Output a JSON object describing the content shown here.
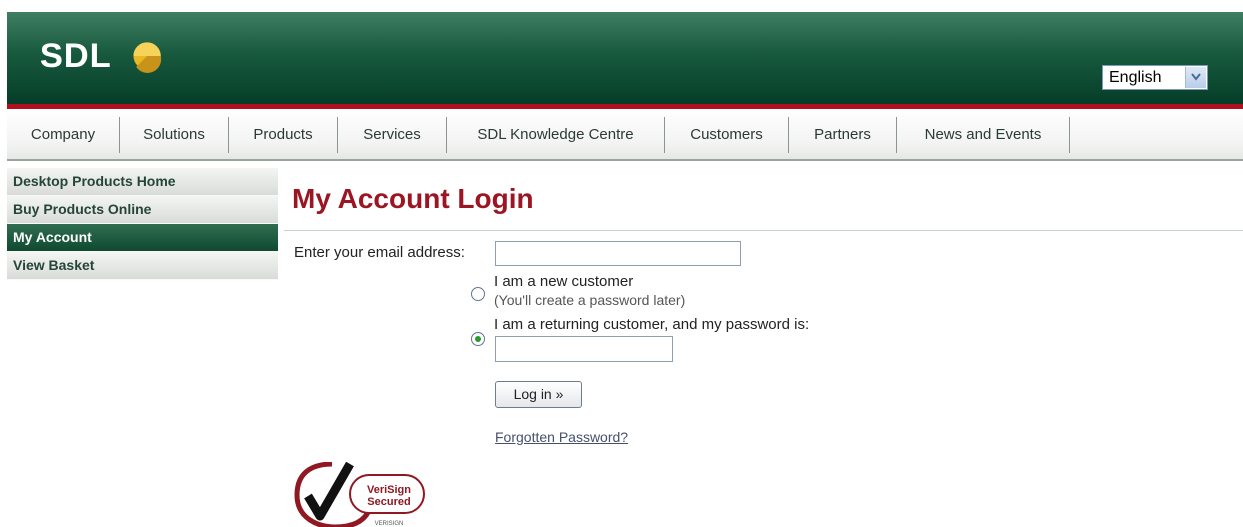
{
  "header": {
    "logo_text": "SDL",
    "language": {
      "selected": "English"
    }
  },
  "nav": {
    "items": [
      {
        "label": "Company"
      },
      {
        "label": "Solutions"
      },
      {
        "label": "Products"
      },
      {
        "label": "Services"
      },
      {
        "label": "SDL Knowledge Centre"
      },
      {
        "label": "Customers"
      },
      {
        "label": "Partners"
      },
      {
        "label": "News and Events"
      }
    ]
  },
  "sidebar": {
    "items": [
      {
        "label": "Desktop Products Home",
        "active": false
      },
      {
        "label": "Buy Products Online",
        "active": false
      },
      {
        "label": "My Account",
        "active": true
      },
      {
        "label": "View Basket",
        "active": false
      }
    ]
  },
  "main": {
    "title": "My Account Login",
    "email_label": "Enter your email address:",
    "email_value": "",
    "options": {
      "new_customer": {
        "label": "I am a new customer",
        "sublabel": "(You'll create a password later)",
        "selected": false
      },
      "returning_customer": {
        "label": "I am a returning customer, and my password is:",
        "selected": true
      }
    },
    "password_value": "",
    "login_button": "Log in »",
    "forgot_link": "Forgotten Password?"
  },
  "verisign": {
    "badge_line1": "VeriSign",
    "badge_line2": "Secured",
    "footer_text": "VERISIGN"
  },
  "colors": {
    "header_green": "#185a3e",
    "accent_red": "#b2101f",
    "title_red": "#9c1522",
    "active_side": "#1f5c40"
  }
}
